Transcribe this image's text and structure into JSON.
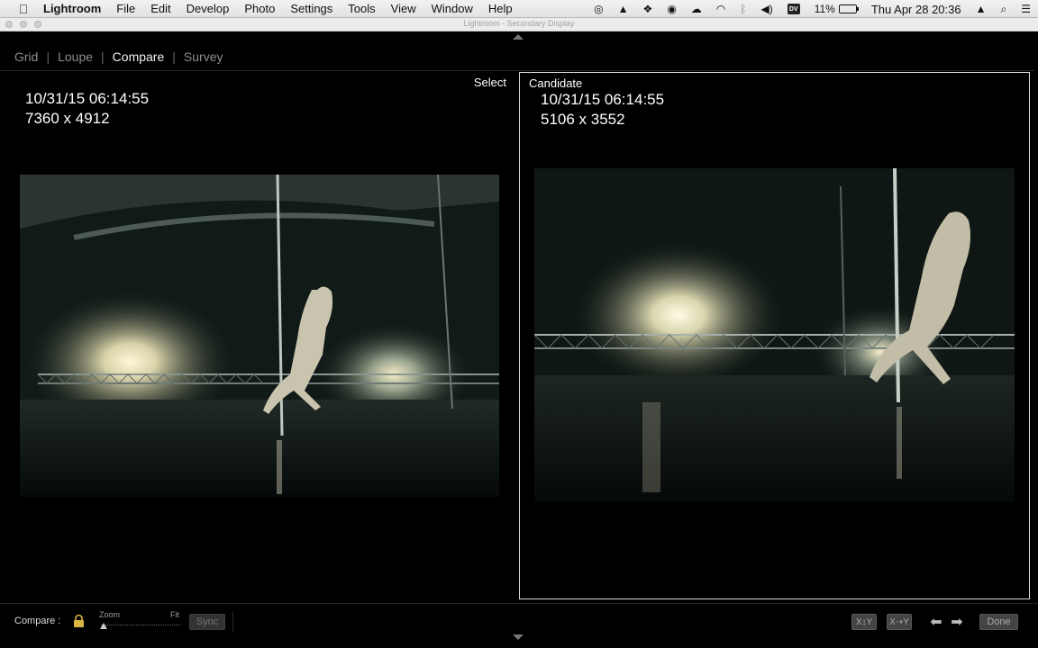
{
  "menubar": {
    "apple_icon": "apple-icon",
    "app_name": "Lightroom",
    "items": [
      "File",
      "Edit",
      "Develop",
      "Photo",
      "Settings",
      "Tools",
      "View",
      "Window",
      "Help"
    ],
    "tray": {
      "battery_percent": "11%",
      "battery_level": 0.11,
      "datetime": "Thu Apr 28  20:36",
      "dv_badge": "DV",
      "icons": [
        "creative-cloud-icon",
        "google-drive-icon",
        "dropbox-icon",
        "sync-icon",
        "cloud-icon",
        "wifi-icon",
        "bluetooth-icon",
        "volume-icon",
        "battery-icon",
        "user-icon",
        "spotlight-icon",
        "notification-center-icon"
      ]
    }
  },
  "window": {
    "title": "Lightroom - Secondary Display"
  },
  "modes": {
    "items": [
      "Grid",
      "Loupe",
      "Compare",
      "Survey"
    ],
    "separator": "|",
    "active": "Compare"
  },
  "select_pane": {
    "label": "Select",
    "datetime": "10/31/15 06:14:55",
    "dimensions": "7360 x 4912"
  },
  "candidate_pane": {
    "label": "Candidate",
    "datetime": "10/31/15 06:14:55",
    "dimensions": "5106 x 3552"
  },
  "toolbar": {
    "compare_label": "Compare :",
    "zoom_label": "Zoom",
    "fit_label": "Fit",
    "zoom_level": 0,
    "sync_label": "Sync",
    "swap_label": "X↕Y",
    "make_select_label": "X⇢Y",
    "prev_icon": "arrow-left-icon",
    "next_icon": "arrow-right-icon",
    "done_label": "Done"
  }
}
